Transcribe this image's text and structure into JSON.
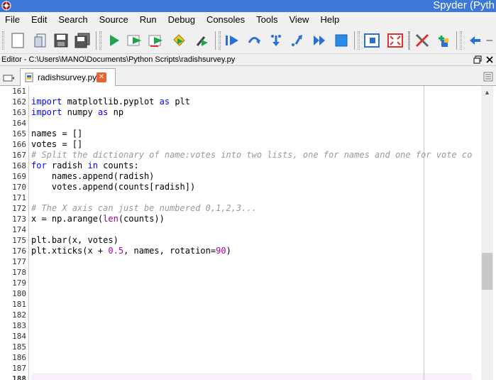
{
  "window": {
    "title": "Spyder (Pyth"
  },
  "menu": {
    "items": [
      "File",
      "Edit",
      "Search",
      "Source",
      "Run",
      "Debug",
      "Consoles",
      "Tools",
      "View",
      "Help"
    ]
  },
  "toolbar": {
    "buttons": [
      {
        "icon": "new-file-icon"
      },
      {
        "icon": "open-file-icon"
      },
      {
        "icon": "save-icon"
      },
      {
        "icon": "save-all-icon"
      },
      {
        "icon": "run-icon"
      },
      {
        "icon": "run-cell-icon"
      },
      {
        "icon": "run-cell-advance-icon"
      },
      {
        "icon": "run-selection-icon"
      },
      {
        "icon": "configure-run-icon"
      },
      {
        "icon": "debug-icon"
      },
      {
        "icon": "step-icon"
      },
      {
        "icon": "step-into-icon"
      },
      {
        "icon": "step-return-icon"
      },
      {
        "icon": "continue-icon"
      },
      {
        "icon": "stop-debug-icon"
      },
      {
        "icon": "maximize-pane-icon"
      },
      {
        "icon": "fullscreen-icon"
      },
      {
        "icon": "preferences-icon"
      },
      {
        "icon": "python-path-manager-icon"
      },
      {
        "icon": "back-icon"
      }
    ]
  },
  "editor": {
    "path": "Editor - C:\\Users\\MANO\\Documents\\Python Scripts\\radishsurvey.py",
    "tab_label": "radishsurvey.py",
    "line_numbers": [
      "161",
      "162",
      "163",
      "164",
      "165",
      "166",
      "167",
      "168",
      "169",
      "170",
      "171",
      "172",
      "173",
      "174",
      "175",
      "176",
      "177",
      "178",
      "179",
      "180",
      "181",
      "182",
      "183",
      "184",
      "185",
      "186",
      "187",
      "188"
    ],
    "lines": [
      "",
      "import matplotlib.pyplot as plt",
      "import numpy as np",
      "",
      "names = []",
      "votes = []",
      "# Split the dictionary of name:votes into two lists, one for names and one for vote count",
      "for radish in counts:",
      "    names.append(radish)",
      "    votes.append(counts[radish])",
      "",
      "# The X axis can just be numbered 0,1,2,3...",
      "x = np.arange(len(counts))",
      "",
      "plt.bar(x, votes)",
      "plt.xticks(x + 0.5, names, rotation=90)",
      "",
      "",
      "",
      "",
      "",
      "",
      "",
      "",
      "",
      "",
      "",
      ""
    ]
  },
  "colors": {
    "titlebar": "#3b78d8",
    "keyword": "#0000ff",
    "number": "#b200b2",
    "comment": "#999999",
    "builtin": "#900090",
    "current_line": "#f9eefb"
  }
}
